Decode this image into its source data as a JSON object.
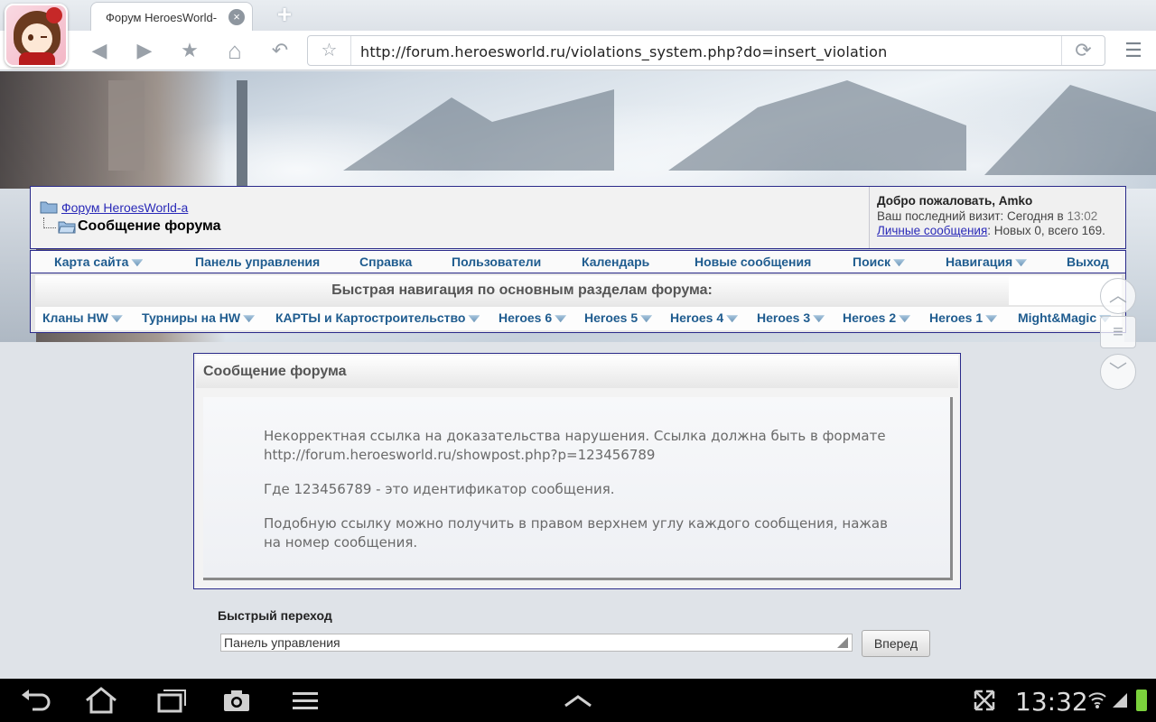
{
  "browser": {
    "tab_title": "Форум HeroesWorld-",
    "tab_close": "×",
    "new_tab": "+",
    "url": "http://forum.heroesworld.ru/violations_system.php?do=insert_violation"
  },
  "icons": {
    "back": "◀",
    "forward": "▶",
    "star": "★",
    "home": "⌂",
    "undo": "↶",
    "bookmark": "☆",
    "sync": "⟳",
    "menu": "☰",
    "up": "︿",
    "list": "≡",
    "down": "﹀"
  },
  "forum": {
    "breadcrumb_root": "Форум HeroesWorld-а",
    "breadcrumb_current": "Сообщение форума",
    "welcome_title": "Добро пожаловать, Amko",
    "last_visit_prefix": "Ваш последний визит: Сегодня в",
    "last_visit_time": "13:02",
    "pm_link": "Личные сообщения",
    "pm_counts": ": Новых 0, всего 169."
  },
  "navbar": {
    "items": [
      "Карта сайта",
      "Панель управления",
      "Справка",
      "Пользователи",
      "Календарь",
      "Новые сообщения",
      "Поиск",
      "Навигация",
      "Выход"
    ]
  },
  "quicknav": {
    "title": "Быстрая навигация по основным разделам форума:",
    "items": [
      "Кланы HW",
      "Турниры на HW",
      "КАРТЫ и Картостроительство",
      "Heroes 6",
      "Heroes 5",
      "Heroes 4",
      "Heroes 3",
      "Heroes 2",
      "Heroes 1",
      "Might&Magic"
    ]
  },
  "message": {
    "title": "Сообщение форума",
    "p1_line1": "Некорректная ссылка на доказательства нарушения. Ссылка должна быть в формате",
    "p1_line2": "http://forum.heroesworld.ru/showpost.php?p=123456789",
    "p2": "Где 123456789 - это идентификатор сообщения.",
    "p3_line1": "Подобную ссылку можно получить в правом верхнем углу каждого сообщения, нажав",
    "p3_line2": "на номер сообщения."
  },
  "jump": {
    "label": "Быстрый переход",
    "selected": "Панель управления",
    "button": "Вперед"
  },
  "system": {
    "time": "13:32"
  }
}
